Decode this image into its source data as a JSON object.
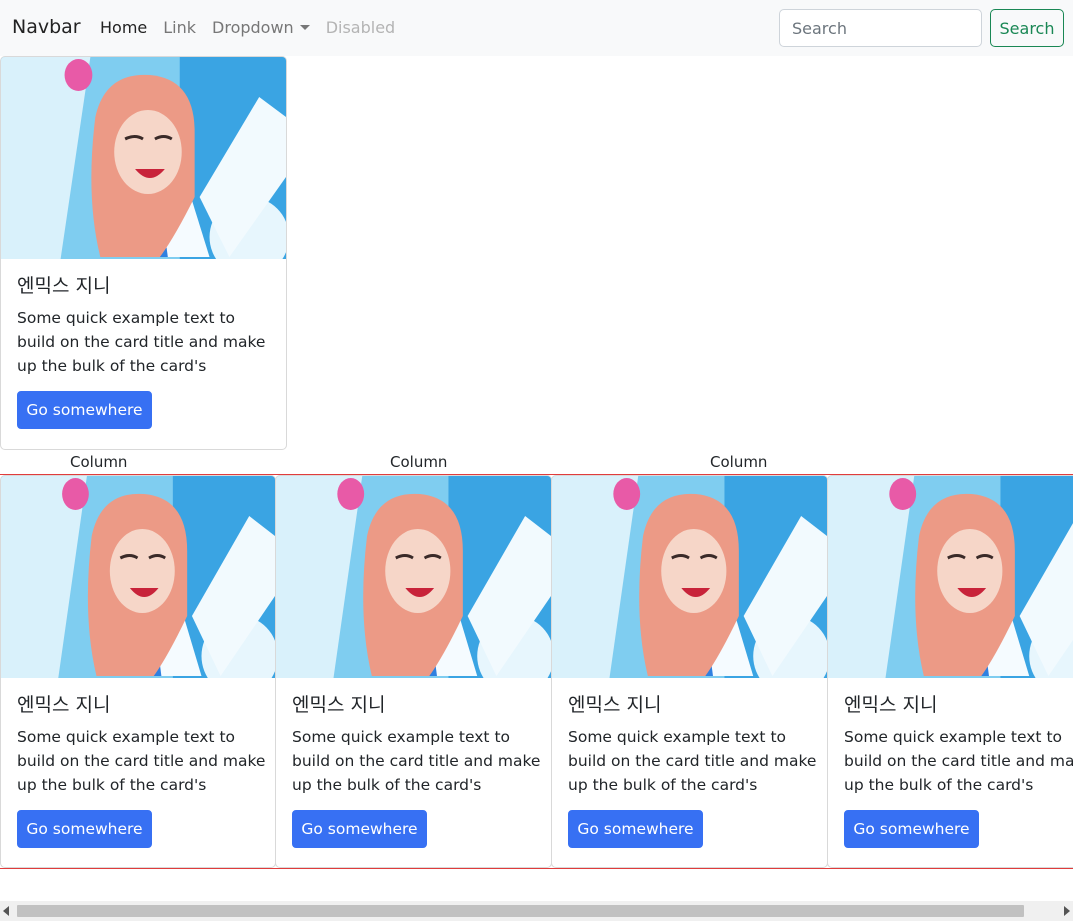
{
  "navbar": {
    "brand": "Navbar",
    "links": [
      {
        "label": "Home"
      },
      {
        "label": "Link"
      },
      {
        "label": "Dropdown"
      },
      {
        "label": "Disabled"
      }
    ],
    "search": {
      "placeholder": "Search",
      "button_label": "Search"
    }
  },
  "cards": [
    {
      "title": "엔믹스 지니",
      "text": "Some quick example text to build on the card title and make up the bulk of the card's content.",
      "button_label": "Go somewhere"
    },
    {
      "title": "엔믹스 지니",
      "text": "Some quick example text to build on the card title and make up the bulk of the card's content.",
      "button_label": "Go somewhere"
    },
    {
      "title": "엔믹스 지니",
      "text": "Some quick example text to build on the card title and make up the bulk of the card's content.",
      "button_label": "Go somewhere"
    },
    {
      "title": "엔믹스 지니",
      "text": "Some quick example text to build on the card title and make up the bulk of the card's content.",
      "button_label": "Go somewhere"
    },
    {
      "title": "엔믹스 지니",
      "text": "Some quick example text to build on the card title and make up the bulk of the card's content.",
      "button_label": "Go somewhere"
    }
  ],
  "columns": [
    "Column",
    "Column",
    "Column"
  ],
  "colors": {
    "primary": "#3770f3",
    "success": "#198754",
    "row_border": "#e03c3c",
    "navbar_bg": "#f8f9fa"
  }
}
